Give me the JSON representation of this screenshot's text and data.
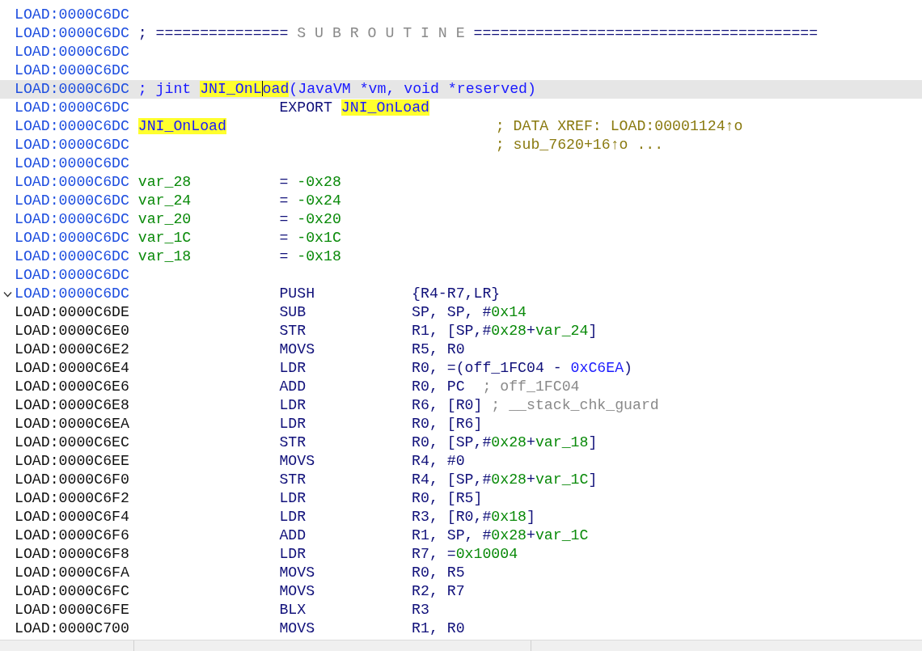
{
  "disassembly": {
    "lines": [
      {
        "address": "LOAD:0000C6DC",
        "kind": "header",
        "selected": false
      },
      {
        "address": "LOAD:0000C6DC",
        "kind": "header",
        "selected": false,
        "cells": [
          {
            "kind": "label",
            "pieces": [
              {
                "text": "; ===============",
                "kind": "plain"
              },
              {
                "text": " S U B R O U T I N E ",
                "kind": "comment"
              },
              {
                "text": "=======================================",
                "kind": "plain"
              }
            ]
          }
        ]
      },
      {
        "address": "LOAD:0000C6DC",
        "kind": "header",
        "selected": false
      },
      {
        "address": "LOAD:0000C6DC",
        "kind": "header",
        "selected": false
      },
      {
        "address": "LOAD:0000C6DC",
        "kind": "header",
        "selected": true,
        "cells": [
          {
            "kind": "label",
            "pieces": [
              {
                "text": "; jint ",
                "kind": "symbol"
              },
              {
                "text": "JNI_OnL",
                "kind": "match",
                "caret": true
              },
              {
                "text": "oad",
                "kind": "match"
              },
              {
                "text": "(JavaVM *vm, void *reserved)",
                "kind": "symbol"
              }
            ]
          }
        ]
      },
      {
        "address": "LOAD:0000C6DC",
        "kind": "header",
        "selected": false,
        "cells": [
          {
            "kind": "mnemonic",
            "pieces": [
              {
                "text": "EXPORT ",
                "kind": "plain"
              },
              {
                "text": "JNI_OnLoad",
                "kind": "match"
              }
            ]
          }
        ]
      },
      {
        "address": "LOAD:0000C6DC",
        "kind": "header",
        "selected": false,
        "cells": [
          {
            "kind": "label",
            "pieces": [
              {
                "text": "JNI_OnLoad",
                "kind": "match"
              }
            ]
          },
          {
            "kind": "xref",
            "pieces": [
              {
                "text": "; DATA XREF: LOAD:00001124↑o",
                "kind": "xref"
              }
            ]
          }
        ]
      },
      {
        "address": "LOAD:0000C6DC",
        "kind": "header",
        "selected": false,
        "cells": [
          {
            "kind": "xref",
            "pieces": [
              {
                "text": "; sub_7620+16↑o ...",
                "kind": "xref"
              }
            ]
          }
        ]
      },
      {
        "address": "LOAD:0000C6DC",
        "kind": "header",
        "selected": false
      },
      {
        "address": "LOAD:0000C6DC",
        "kind": "header",
        "selected": false,
        "cells": [
          {
            "kind": "label",
            "pieces": [
              {
                "text": "var_28",
                "kind": "number"
              }
            ]
          },
          {
            "kind": "mnemonic",
            "pieces": [
              {
                "text": "= ",
                "kind": "plain"
              },
              {
                "text": "-0x28",
                "kind": "number"
              }
            ]
          }
        ]
      },
      {
        "address": "LOAD:0000C6DC",
        "kind": "header",
        "selected": false,
        "cells": [
          {
            "kind": "label",
            "pieces": [
              {
                "text": "var_24",
                "kind": "number"
              }
            ]
          },
          {
            "kind": "mnemonic",
            "pieces": [
              {
                "text": "= ",
                "kind": "plain"
              },
              {
                "text": "-0x24",
                "kind": "number"
              }
            ]
          }
        ]
      },
      {
        "address": "LOAD:0000C6DC",
        "kind": "header",
        "selected": false,
        "cells": [
          {
            "kind": "label",
            "pieces": [
              {
                "text": "var_20",
                "kind": "number"
              }
            ]
          },
          {
            "kind": "mnemonic",
            "pieces": [
              {
                "text": "= ",
                "kind": "plain"
              },
              {
                "text": "-0x20",
                "kind": "number"
              }
            ]
          }
        ]
      },
      {
        "address": "LOAD:0000C6DC",
        "kind": "header",
        "selected": false,
        "cells": [
          {
            "kind": "label",
            "pieces": [
              {
                "text": "var_1C",
                "kind": "number"
              }
            ]
          },
          {
            "kind": "mnemonic",
            "pieces": [
              {
                "text": "= ",
                "kind": "plain"
              },
              {
                "text": "-0x1C",
                "kind": "number"
              }
            ]
          }
        ]
      },
      {
        "address": "LOAD:0000C6DC",
        "kind": "header",
        "selected": false,
        "cells": [
          {
            "kind": "label",
            "pieces": [
              {
                "text": "var_18",
                "kind": "number"
              }
            ]
          },
          {
            "kind": "mnemonic",
            "pieces": [
              {
                "text": "= ",
                "kind": "plain"
              },
              {
                "text": "-0x18",
                "kind": "number"
              }
            ]
          }
        ]
      },
      {
        "address": "LOAD:0000C6DC",
        "kind": "header",
        "selected": false
      },
      {
        "address": "LOAD:0000C6DC",
        "kind": "entry",
        "selected": false,
        "expanded": true,
        "cells": [
          {
            "kind": "mnemonic",
            "pieces": [
              {
                "text": "PUSH",
                "kind": "plain"
              }
            ]
          },
          {
            "kind": "operand",
            "pieces": [
              {
                "text": "{R4-R7,LR}",
                "kind": "plain"
              }
            ]
          }
        ]
      },
      {
        "address": "LOAD:0000C6DE",
        "kind": "code",
        "selected": false,
        "cells": [
          {
            "kind": "mnemonic",
            "pieces": [
              {
                "text": "SUB",
                "kind": "plain"
              }
            ]
          },
          {
            "kind": "operand",
            "pieces": [
              {
                "text": "SP, SP, #",
                "kind": "plain"
              },
              {
                "text": "0x14",
                "kind": "number"
              }
            ]
          }
        ]
      },
      {
        "address": "LOAD:0000C6E0",
        "kind": "code",
        "selected": false,
        "cells": [
          {
            "kind": "mnemonic",
            "pieces": [
              {
                "text": "STR",
                "kind": "plain"
              }
            ]
          },
          {
            "kind": "operand",
            "pieces": [
              {
                "text": "R1, [SP,#",
                "kind": "plain"
              },
              {
                "text": "0x28",
                "kind": "number"
              },
              {
                "text": "+",
                "kind": "plain"
              },
              {
                "text": "var_24",
                "kind": "number"
              },
              {
                "text": "]",
                "kind": "plain"
              }
            ]
          }
        ]
      },
      {
        "address": "LOAD:0000C6E2",
        "kind": "code",
        "selected": false,
        "cells": [
          {
            "kind": "mnemonic",
            "pieces": [
              {
                "text": "MOVS",
                "kind": "plain"
              }
            ]
          },
          {
            "kind": "operand",
            "pieces": [
              {
                "text": "R5, R0",
                "kind": "plain"
              }
            ]
          }
        ]
      },
      {
        "address": "LOAD:0000C6E4",
        "kind": "code",
        "selected": false,
        "cells": [
          {
            "kind": "mnemonic",
            "pieces": [
              {
                "text": "LDR",
                "kind": "plain"
              }
            ]
          },
          {
            "kind": "operand",
            "pieces": [
              {
                "text": "R0, =(off_1FC04 - ",
                "kind": "plain"
              },
              {
                "text": "0xC6EA",
                "kind": "symbol"
              },
              {
                "text": ")",
                "kind": "plain"
              }
            ]
          }
        ]
      },
      {
        "address": "LOAD:0000C6E6",
        "kind": "code",
        "selected": false,
        "cells": [
          {
            "kind": "mnemonic",
            "pieces": [
              {
                "text": "ADD",
                "kind": "plain"
              }
            ]
          },
          {
            "kind": "operand",
            "pieces": [
              {
                "text": "R0, PC  ",
                "kind": "plain"
              },
              {
                "text": "; off_1FC04",
                "kind": "comment"
              }
            ]
          }
        ]
      },
      {
        "address": "LOAD:0000C6E8",
        "kind": "code",
        "selected": false,
        "cells": [
          {
            "kind": "mnemonic",
            "pieces": [
              {
                "text": "LDR",
                "kind": "plain"
              }
            ]
          },
          {
            "kind": "operand",
            "pieces": [
              {
                "text": "R6, [R0] ",
                "kind": "plain"
              },
              {
                "text": "; __stack_chk_guard",
                "kind": "comment"
              }
            ]
          }
        ]
      },
      {
        "address": "LOAD:0000C6EA",
        "kind": "code",
        "selected": false,
        "cells": [
          {
            "kind": "mnemonic",
            "pieces": [
              {
                "text": "LDR",
                "kind": "plain"
              }
            ]
          },
          {
            "kind": "operand",
            "pieces": [
              {
                "text": "R0, [R6]",
                "kind": "plain"
              }
            ]
          }
        ]
      },
      {
        "address": "LOAD:0000C6EC",
        "kind": "code",
        "selected": false,
        "cells": [
          {
            "kind": "mnemonic",
            "pieces": [
              {
                "text": "STR",
                "kind": "plain"
              }
            ]
          },
          {
            "kind": "operand",
            "pieces": [
              {
                "text": "R0, [SP,#",
                "kind": "plain"
              },
              {
                "text": "0x28",
                "kind": "number"
              },
              {
                "text": "+",
                "kind": "plain"
              },
              {
                "text": "var_18",
                "kind": "number"
              },
              {
                "text": "]",
                "kind": "plain"
              }
            ]
          }
        ]
      },
      {
        "address": "LOAD:0000C6EE",
        "kind": "code",
        "selected": false,
        "cells": [
          {
            "kind": "mnemonic",
            "pieces": [
              {
                "text": "MOVS",
                "kind": "plain"
              }
            ]
          },
          {
            "kind": "operand",
            "pieces": [
              {
                "text": "R4, #0",
                "kind": "plain"
              }
            ]
          }
        ]
      },
      {
        "address": "LOAD:0000C6F0",
        "kind": "code",
        "selected": false,
        "cells": [
          {
            "kind": "mnemonic",
            "pieces": [
              {
                "text": "STR",
                "kind": "plain"
              }
            ]
          },
          {
            "kind": "operand",
            "pieces": [
              {
                "text": "R4, [SP,#",
                "kind": "plain"
              },
              {
                "text": "0x28",
                "kind": "number"
              },
              {
                "text": "+",
                "kind": "plain"
              },
              {
                "text": "var_1C",
                "kind": "number"
              },
              {
                "text": "]",
                "kind": "plain"
              }
            ]
          }
        ]
      },
      {
        "address": "LOAD:0000C6F2",
        "kind": "code",
        "selected": false,
        "cells": [
          {
            "kind": "mnemonic",
            "pieces": [
              {
                "text": "LDR",
                "kind": "plain"
              }
            ]
          },
          {
            "kind": "operand",
            "pieces": [
              {
                "text": "R0, [R5]",
                "kind": "plain"
              }
            ]
          }
        ]
      },
      {
        "address": "LOAD:0000C6F4",
        "kind": "code",
        "selected": false,
        "cells": [
          {
            "kind": "mnemonic",
            "pieces": [
              {
                "text": "LDR",
                "kind": "plain"
              }
            ]
          },
          {
            "kind": "operand",
            "pieces": [
              {
                "text": "R3, [R0,#",
                "kind": "plain"
              },
              {
                "text": "0x18",
                "kind": "number"
              },
              {
                "text": "]",
                "kind": "plain"
              }
            ]
          }
        ]
      },
      {
        "address": "LOAD:0000C6F6",
        "kind": "code",
        "selected": false,
        "cells": [
          {
            "kind": "mnemonic",
            "pieces": [
              {
                "text": "ADD",
                "kind": "plain"
              }
            ]
          },
          {
            "kind": "operand",
            "pieces": [
              {
                "text": "R1, SP, #",
                "kind": "plain"
              },
              {
                "text": "0x28",
                "kind": "number"
              },
              {
                "text": "+",
                "kind": "plain"
              },
              {
                "text": "var_1C",
                "kind": "number"
              }
            ]
          }
        ]
      },
      {
        "address": "LOAD:0000C6F8",
        "kind": "code",
        "selected": false,
        "cells": [
          {
            "kind": "mnemonic",
            "pieces": [
              {
                "text": "LDR",
                "kind": "plain"
              }
            ]
          },
          {
            "kind": "operand",
            "pieces": [
              {
                "text": "R7, =",
                "kind": "plain"
              },
              {
                "text": "0x10004",
                "kind": "number"
              }
            ]
          }
        ]
      },
      {
        "address": "LOAD:0000C6FA",
        "kind": "code",
        "selected": false,
        "cells": [
          {
            "kind": "mnemonic",
            "pieces": [
              {
                "text": "MOVS",
                "kind": "plain"
              }
            ]
          },
          {
            "kind": "operand",
            "pieces": [
              {
                "text": "R0, R5",
                "kind": "plain"
              }
            ]
          }
        ]
      },
      {
        "address": "LOAD:0000C6FC",
        "kind": "code",
        "selected": false,
        "cells": [
          {
            "kind": "mnemonic",
            "pieces": [
              {
                "text": "MOVS",
                "kind": "plain"
              }
            ]
          },
          {
            "kind": "operand",
            "pieces": [
              {
                "text": "R2, R7",
                "kind": "plain"
              }
            ]
          }
        ]
      },
      {
        "address": "LOAD:0000C6FE",
        "kind": "code",
        "selected": false,
        "cells": [
          {
            "kind": "mnemonic",
            "pieces": [
              {
                "text": "BLX",
                "kind": "plain"
              }
            ]
          },
          {
            "kind": "operand",
            "pieces": [
              {
                "text": "R3",
                "kind": "plain"
              }
            ]
          }
        ]
      },
      {
        "address": "LOAD:0000C700",
        "kind": "code",
        "selected": false,
        "cells": [
          {
            "kind": "mnemonic",
            "pieces": [
              {
                "text": "MOVS",
                "kind": "plain"
              }
            ]
          },
          {
            "kind": "operand",
            "pieces": [
              {
                "text": "R1, R0",
                "kind": "plain"
              }
            ]
          }
        ]
      }
    ]
  }
}
